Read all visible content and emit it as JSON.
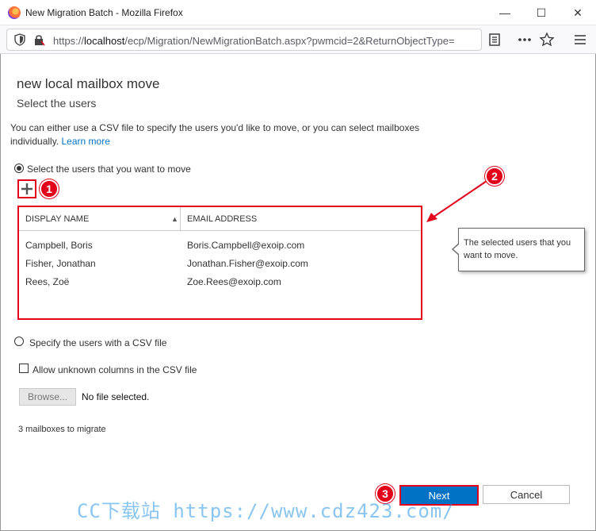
{
  "window": {
    "title": "New Migration Batch - Mozilla Firefox",
    "minimize_glyph": "—",
    "maximize_glyph": "☐",
    "close_glyph": "✕"
  },
  "navbar": {
    "url_prefix": "https://",
    "url_host": "localhost",
    "url_rest": "/ecp/Migration/NewMigrationBatch.aspx?pwmcid=2&ReturnObjectType=",
    "icons": [
      "shield-icon",
      "lock-icon",
      "reader-view-icon",
      "more-icon",
      "star-icon",
      "menu-icon"
    ]
  },
  "page": {
    "heading": "new local mailbox move",
    "subheading": "Select the users",
    "description": "You can either use a CSV file to specify the users you'd like to move, or you can select mailboxes individually.",
    "learn_more": "Learn more",
    "option_select_users": "Select the users that you want to move",
    "option_csv": "Specify the users with a CSV file",
    "allow_unknown_columns": "Allow unknown columns in the CSV file",
    "browse_label": "Browse...",
    "no_file": "No file selected.",
    "count_text": "3 mailboxes to migrate",
    "next_label": "Next",
    "cancel_label": "Cancel",
    "tooltip": "The selected users that you want to move."
  },
  "grid": {
    "columns": [
      "DISPLAY NAME",
      "EMAIL ADDRESS"
    ],
    "rows": [
      {
        "name": "Campbell, Boris",
        "email": "Boris.Campbell@exoip.com"
      },
      {
        "name": "Fisher, Jonathan",
        "email": "Jonathan.Fisher@exoip.com"
      },
      {
        "name": "Rees, Zoë",
        "email": "Zoe.Rees@exoip.com"
      }
    ]
  },
  "callouts": [
    "1",
    "2",
    "3"
  ],
  "watermark": "CC下载站 https://www.cdz423.com/",
  "colors": {
    "accent": "#0072c6",
    "callout_red": "#e2001a"
  }
}
